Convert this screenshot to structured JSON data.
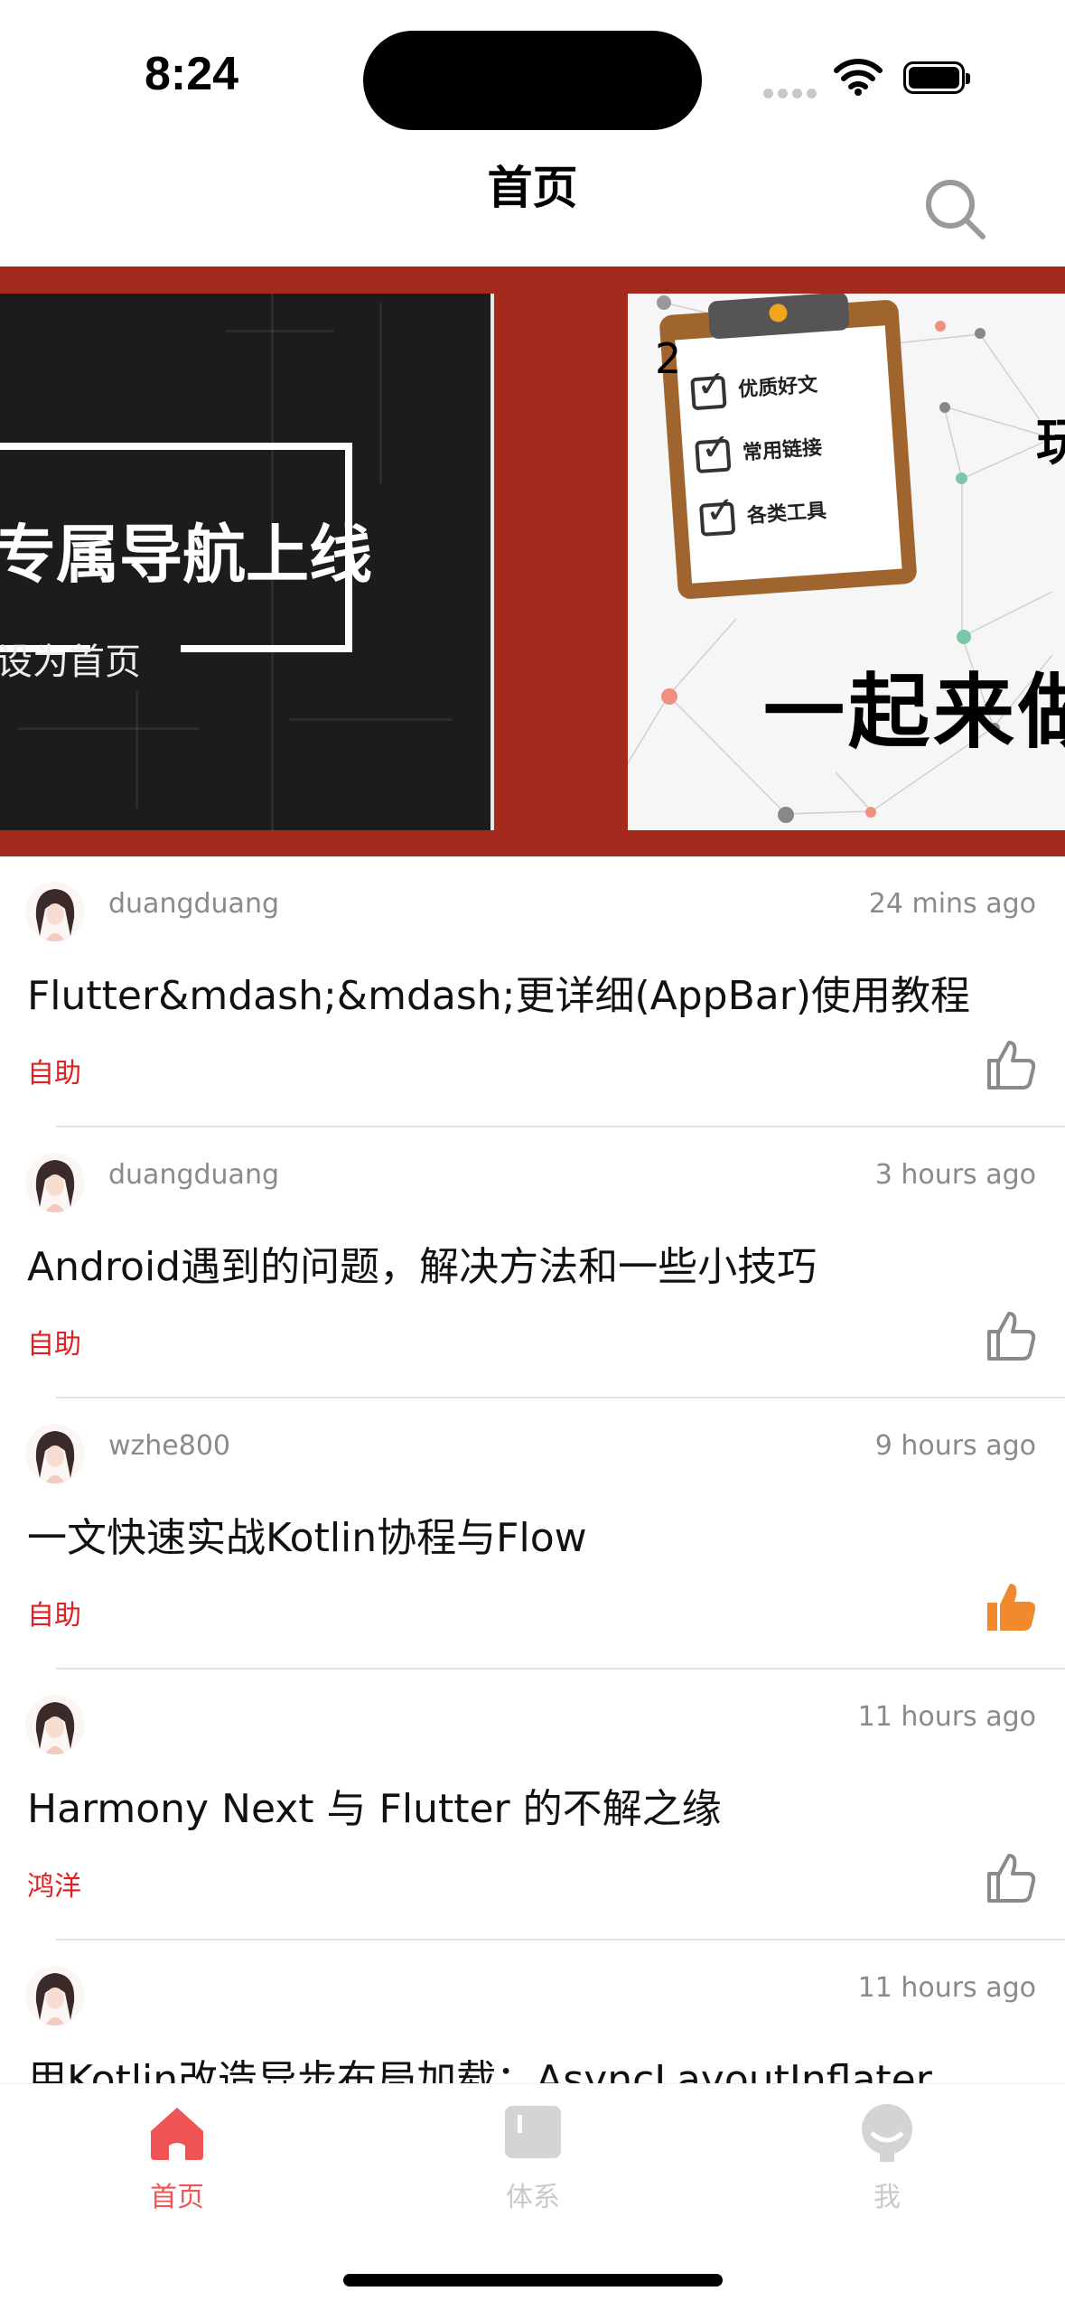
{
  "status_bar": {
    "time": "8:24"
  },
  "header": {
    "title": "首页",
    "search_icon": "search-icon"
  },
  "banner": {
    "slide_left": {
      "headline": "专属导航上线",
      "subtext": "设为首页"
    },
    "slide_right": {
      "index": "2",
      "checklist": [
        "优质好文",
        "常用链接",
        "各类工具"
      ],
      "slogan": "一起来做",
      "side_char": "玩"
    },
    "page_count": 3,
    "active_page": 1
  },
  "articles": [
    {
      "author": "duangduang",
      "time": "24 mins ago",
      "title": "Flutter&mdash;&mdash;更详细(AppBar)使用教程",
      "tag": "自助",
      "liked": false
    },
    {
      "author": "duangduang",
      "time": "3 hours ago",
      "title": "Android遇到的问题，解决方法和一些小技巧",
      "tag": "自助",
      "liked": false
    },
    {
      "author": "wzhe800",
      "time": "9 hours ago",
      "title": "一文快速实战Kotlin协程与Flow",
      "tag": "自助",
      "liked": true
    },
    {
      "author": "",
      "time": "11 hours ago",
      "title": "Harmony Next 与 Flutter 的不解之缘",
      "tag": "鸿洋",
      "liked": false
    },
    {
      "author": "",
      "time": "11 hours ago",
      "title": "用Kotlin改造异步布局加载：AsyncLayoutInflater",
      "tag": "",
      "liked": false
    }
  ],
  "tabbar": {
    "tabs": [
      {
        "label": "首页",
        "icon": "home-icon",
        "active": true
      },
      {
        "label": "体系",
        "icon": "book-icon",
        "active": false
      },
      {
        "label": "我",
        "icon": "profile-icon",
        "active": false
      }
    ],
    "active_color": "#f05454",
    "inactive_color": "#c9c9c9"
  },
  "colors": {
    "banner_bg": "#a52a1e",
    "tag_red": "#e02020",
    "like_orange": "#f08a2c"
  }
}
